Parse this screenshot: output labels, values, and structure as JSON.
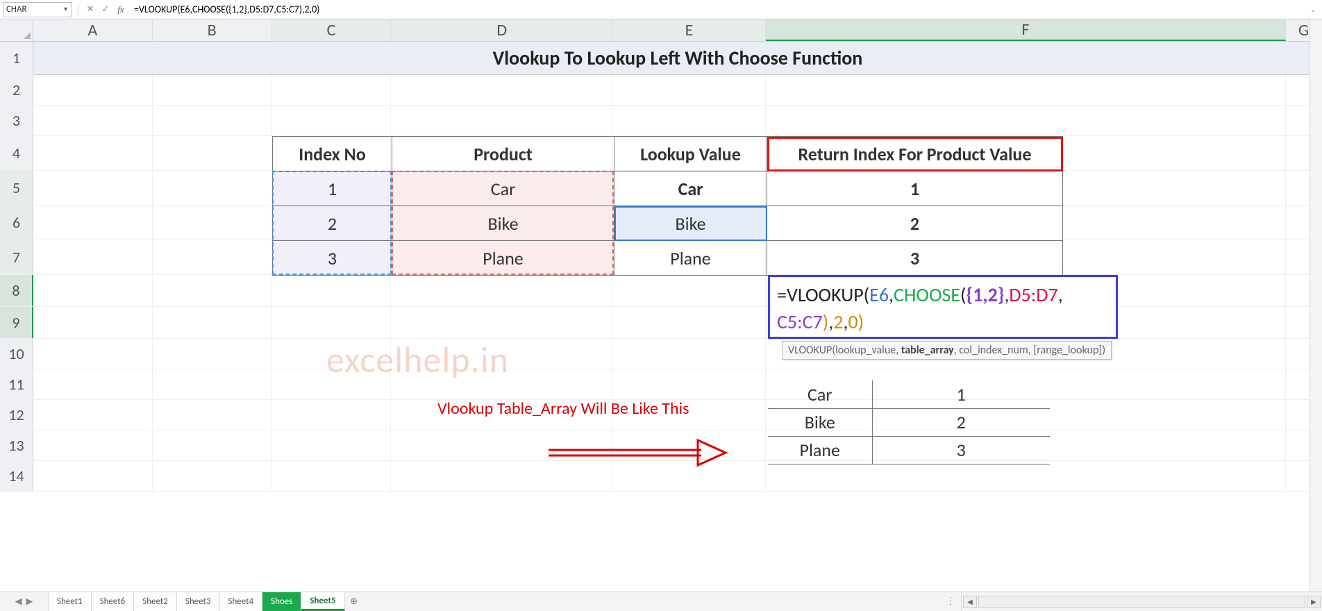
{
  "name_box": "CHAR",
  "formula_bar": "=VLOOKUP(E6,CHOOSE({1,2},D5:D7,C5:C7),2,0)",
  "columns": [
    "A",
    "B",
    "C",
    "D",
    "E",
    "F",
    "G"
  ],
  "rows": [
    "1",
    "2",
    "3",
    "4",
    "5",
    "6",
    "7",
    "8",
    "9",
    "10",
    "11",
    "12",
    "13",
    "14"
  ],
  "title": "Vlookup To Lookup Left With Choose Function",
  "table": {
    "headers": {
      "C": "Index No",
      "D": "Product",
      "E": "Lookup Value",
      "F": "Return Index For Product Value"
    },
    "rows": [
      {
        "C": "1",
        "D": "Car",
        "E": "Car",
        "F": "1"
      },
      {
        "C": "2",
        "D": "Bike",
        "E": "Bike",
        "F": "2"
      },
      {
        "C": "3",
        "D": "Plane",
        "E": "Plane",
        "F": "3"
      }
    ]
  },
  "formula_expanded": {
    "eq": "=",
    "fn": "VLOOKUP",
    "open1": "(",
    "ref1": "E6",
    "c1": ",",
    "fn2": "CHOOSE",
    "open2": "(",
    "arr": "{1,2}",
    "c2": ",",
    "rngD": "D5:D7",
    "c3": ",",
    "rngC": "C5:C7",
    "close2": ")",
    "c4": ",",
    "n2": "2",
    "c5": ",",
    "n0": "0",
    "close1": ")"
  },
  "syntax_tip": {
    "fn": "VLOOKUP(",
    "a1": "lookup_value, ",
    "a2_bold": "table_array",
    "a3": ", col_index_num, [range_lookup])"
  },
  "watermark": "excelhelp.in",
  "annotation": "Vlookup Table_Array Will Be Like This",
  "small_table": [
    {
      "p": "Car",
      "i": "1"
    },
    {
      "p": "Bike",
      "i": "2"
    },
    {
      "p": "Plane",
      "i": "3"
    }
  ],
  "sheet_tabs": [
    "Sheet1",
    "Sheet6",
    "Sheet2",
    "Sheet3",
    "Sheet4",
    "Shoes",
    "Sheet5"
  ],
  "active_tab": "Sheet5",
  "green_tab": "Shoes",
  "add_tab_glyph": "⊕",
  "chart_data": {
    "type": "table",
    "title": "Vlookup To Lookup Left With Choose Function",
    "columns": [
      "Index No",
      "Product",
      "Lookup Value",
      "Return Index For Product Value"
    ],
    "rows": [
      [
        1,
        "Car",
        "Car",
        1
      ],
      [
        2,
        "Bike",
        "Bike",
        2
      ],
      [
        3,
        "Plane",
        "Plane",
        3
      ]
    ],
    "formula_cell": "F6",
    "formula": "=VLOOKUP(E6,CHOOSE({1,2},D5:D7,C5:C7),2,0)",
    "virtual_table_array": [
      [
        "Car",
        1
      ],
      [
        "Bike",
        2
      ],
      [
        "Plane",
        3
      ]
    ]
  }
}
